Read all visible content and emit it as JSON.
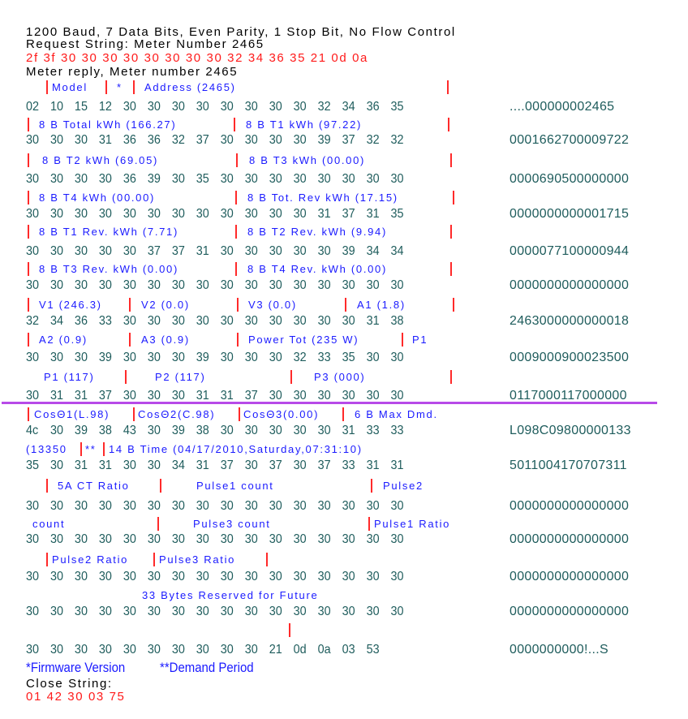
{
  "header": {
    "settings": "1200 Baud, 7 Data Bits, Even Parity, 1 Stop Bit, No Flow Control",
    "request_title": "Request String: Meter Number 2465",
    "request_hex": "2f 3f 30 30 30 30 30 30 30 30 32 34 36 35 21 0d 0a",
    "reply_title": "Meter reply, Meter number 2465"
  },
  "colors": {
    "label_text": "#1a1aff",
    "separator": "#ff2a2a",
    "hex_text": "#1e5c5c",
    "request_hex": "#ff1a1a",
    "divider": "#b84ae8"
  },
  "blocks": [
    {
      "labels": [
        "|",
        "Model",
        "|",
        "*",
        "|",
        "Address (2465)",
        "|"
      ],
      "hex": "02 10 15 12 30 30 30 30 30 30 30 30 32 34 36 35",
      "ascii": "....000000002465"
    },
    {
      "labels": [
        "|",
        "8 B Total kWh (166.27)",
        "|",
        "8 B T1 kWh (97.22)",
        "|"
      ],
      "hex": "30 30 30 31 36 36 32 37 30 30 30 30 39 37 32 32",
      "ascii": "0001662700009722"
    },
    {
      "labels": [
        "|",
        "8 B T2 kWh (69.05)",
        "|",
        "8 B T3 kWh (00.00)",
        "|"
      ],
      "hex": "30 30 30 30 36 39 30 35 30 30 30 30 30 30 30 30",
      "ascii": "0000690500000000"
    },
    {
      "labels": [
        "|",
        "8 B T4 kWh (00.00)",
        "|",
        "8 B Tot. Rev kWh (17.15)",
        "|"
      ],
      "hex": "30 30 30 30 30 30 30 30 30 30 30 30 31 37 31 35",
      "ascii": "0000000000001715"
    },
    {
      "labels": [
        "|",
        "8 B T1 Rev. kWh (7.71)",
        "|",
        "8 B T2 Rev. kWh (9.94)",
        "|"
      ],
      "hex": "30 30 30 30 30 37 37 31 30 30 30 30 30 39 34 34",
      "ascii": "0000077100000944"
    },
    {
      "labels": [
        "|",
        "8 B T3 Rev. kWh (0.00)",
        "|",
        "8 B T4 Rev. kWh (0.00)",
        "|"
      ],
      "hex": "30 30 30 30 30 30 30 30 30 30 30 30 30 30 30 30",
      "ascii": "0000000000000000"
    },
    {
      "labels": [
        "|",
        "V1 (246.3)",
        "|",
        "V2 (0.0)",
        "|",
        "V3 (0.0)",
        "|",
        "A1 (1.8)",
        "|"
      ],
      "hex": "32 34 36 33 30 30 30 30 30 30 30 30 30 30 31 38",
      "ascii": "2463000000000018"
    },
    {
      "labels": [
        "|",
        "A2 (0.9)",
        "|",
        "A3 (0.9)",
        "|",
        "Power Tot (235 W)",
        "|",
        "P1"
      ],
      "hex": "30 30 30 39 30 30 30 39 30 30 30 32 33 35 30 30",
      "ascii": "0009000900023500"
    },
    {
      "labels": [
        "P1 (117)",
        "|",
        "P2 (117)",
        "|",
        "P3 (000)",
        "|"
      ],
      "hex": "30 31 31 37 30 30 30 31 31 37 30 30 30 30 30 30",
      "ascii": "0117000117000000"
    },
    {
      "labels": [
        "|",
        "CosΘ1(L.98)",
        "|",
        "CosΘ2(C.98)",
        "|",
        "CosΘ3(0.00)",
        "|",
        "6 B Max Dmd."
      ],
      "hex": "4c 30 39 38 43 30 39 38 30 30 30 30 30 31 33 33",
      "ascii": "L098C09800000133"
    },
    {
      "labels": [
        "(13350",
        "|",
        "**",
        "|",
        "14 B Time (04/17/2010,Saturday,07:31:10)"
      ],
      "hex": "35 30 31 31 30 30 34 31 37 30 37 30 37 33 31 31",
      "ascii": "5011004170707311"
    },
    {
      "labels": [
        "|",
        "5A CT Ratio",
        "|",
        "Pulse1 count",
        "|",
        "Pulse2"
      ],
      "hex": "30 30 30 30 30 30 30 30 30 30 30 30 30 30 30 30",
      "ascii": "0000000000000000"
    },
    {
      "labels": [
        "count",
        "|",
        "Pulse3 count",
        "|",
        "Pulse1 Ratio"
      ],
      "hex": "30 30 30 30 30 30 30 30 30 30 30 30 30 30 30 30",
      "ascii": "0000000000000000"
    },
    {
      "labels": [
        "|",
        "Pulse2 Ratio",
        "|",
        "Pulse3 Ratio",
        "|"
      ],
      "hex": "30 30 30 30 30 30 30 30 30 30 30 30 30 30 30 30",
      "ascii": "0000000000000000"
    },
    {
      "labels": [
        "33 Bytes Reserved for Future"
      ],
      "hex": "30 30 30 30 30 30 30 30 30 30 30 30 30 30 30 30",
      "ascii": "0000000000000000"
    },
    {
      "labels": [
        "|"
      ],
      "hex": "30 30 30 30 30 30 30 30 30 30 21 0d 0a 03 53",
      "ascii": "0000000000!...S"
    }
  ],
  "footnotes": {
    "firmware": "*Firmware Version",
    "demand": "**Demand Period"
  },
  "close": {
    "title": "Close String:",
    "hex": "01 42 30 03 75"
  }
}
